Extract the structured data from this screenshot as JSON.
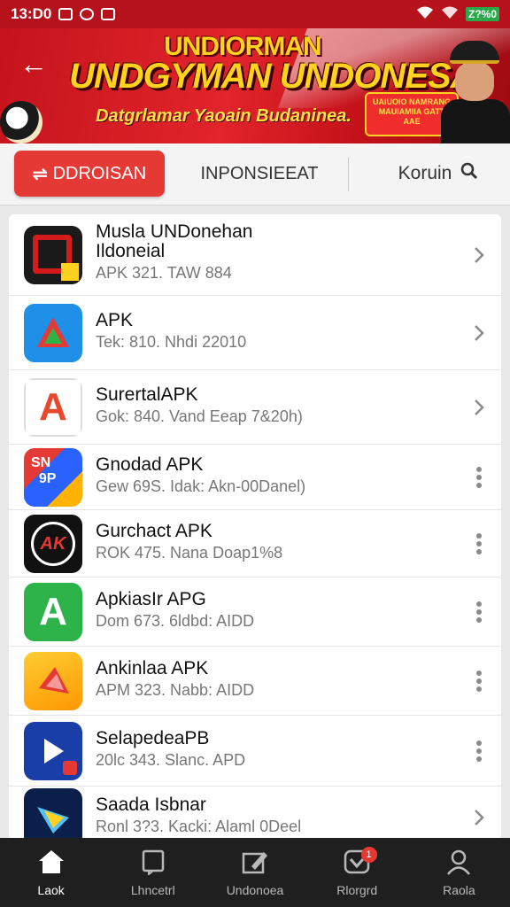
{
  "status_bar": {
    "time": "13:D0",
    "battery": "Z?%0"
  },
  "banner": {
    "line1": "UNDIORMAN",
    "line2": "UNDGYMAN UNDONESA!",
    "line3": "Datgrlamar Yaoain Budaninea.",
    "badge": "UAIUOIO NAMRANG MAUIAMIIA GATT AAE"
  },
  "tabs": {
    "active": "DDROISAN",
    "second": "INPONSIEEAT",
    "search": "Koruin"
  },
  "apps": [
    {
      "title": "Musla UNDonehan",
      "title2": "Ildoneial",
      "subtitle": "APK 321. TAW 884",
      "action": "chevron",
      "icon": "pp-red-icon",
      "colors": [
        "#d31b1b",
        "#1a1a1a"
      ]
    },
    {
      "title": "APK",
      "subtitle": "Tek: 810. Nhdi 22010",
      "action": "chevron",
      "icon": "triangle-blue-icon",
      "colors": [
        "#1f8fe8",
        "#e53935",
        "#2db34a"
      ]
    },
    {
      "title": "SurertalAPK",
      "subtitle": "Gok: 840. Vand Eeap 7&20h)",
      "action": "chevron",
      "icon": "red-a-icon",
      "colors": [
        "#e64a2e",
        "#ffffff"
      ]
    },
    {
      "title": "Gnodad APK",
      "subtitle": "Gew 69S. Idak: Akn-00Danel)",
      "action": "dots",
      "icon": "multicolor-sn-icon",
      "colors": [
        "#e53935",
        "#2962ff",
        "#ffb300"
      ]
    },
    {
      "title": "Gurchact APK",
      "subtitle": "ROK 475. Nana Doap1%8",
      "action": "dots",
      "icon": "black-ak-icon",
      "colors": [
        "#111111",
        "#e53935"
      ]
    },
    {
      "title": "ApkiasIr APG",
      "subtitle": "Dom 673. 6ldbd: AIDD",
      "action": "dots",
      "icon": "green-a-icon",
      "colors": [
        "#2db34a",
        "#ffffff"
      ]
    },
    {
      "title": "Ankinlaa APK",
      "subtitle": "APM 323. Nabb: AIDD",
      "action": "dots",
      "icon": "orange-kite-icon",
      "colors": [
        "#ff9800",
        "#e53935"
      ]
    },
    {
      "title": "SelapedeaPB",
      "subtitle": "20lc 343. Slanc. APD",
      "action": "dots",
      "icon": "blue-play-icon",
      "colors": [
        "#1a3ea8",
        "#e53935"
      ]
    },
    {
      "title": "Saada Isbnar",
      "subtitle": "Ronl 3?3. Kacki: Alaml 0Deel",
      "action": "chevron",
      "icon": "blue-star-icon",
      "colors": [
        "#0b1f4a",
        "#4fc3f7"
      ]
    }
  ],
  "nav": [
    {
      "label": "Laok",
      "icon": "home-icon",
      "active": true,
      "badge": ""
    },
    {
      "label": "Lhncetrl",
      "icon": "book-icon",
      "active": false,
      "badge": ""
    },
    {
      "label": "Undonoea",
      "icon": "edit-icon",
      "active": false,
      "badge": ""
    },
    {
      "label": "Rlorgrd",
      "icon": "download-icon",
      "active": false,
      "badge": "1"
    },
    {
      "label": "Raola",
      "icon": "profile-icon",
      "active": false,
      "badge": ""
    }
  ]
}
